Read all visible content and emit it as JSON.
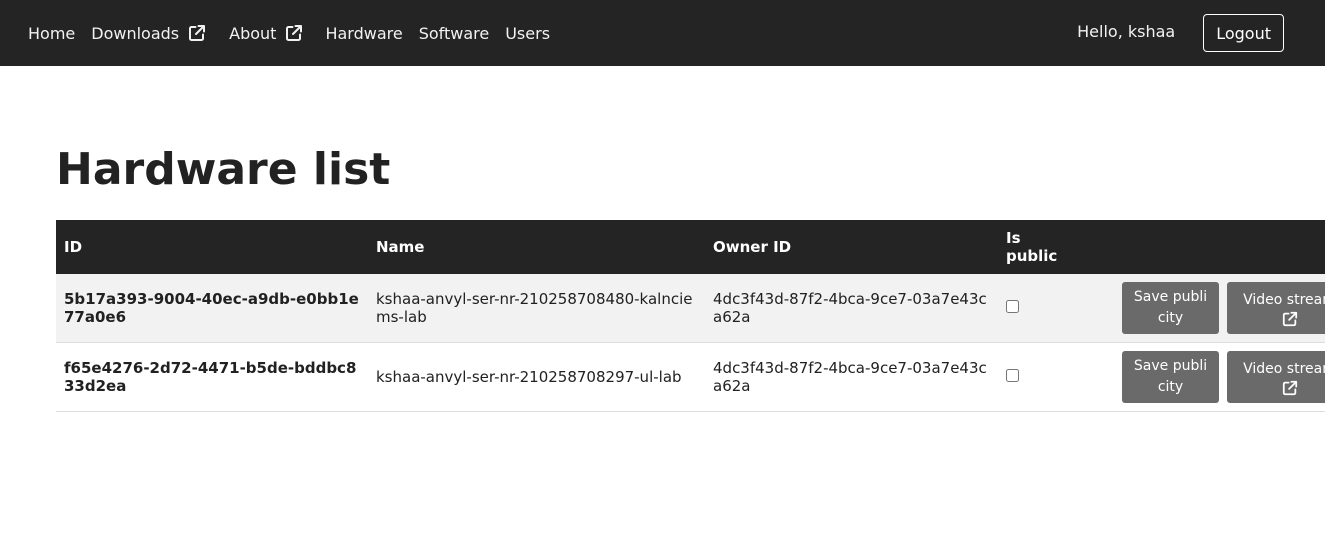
{
  "nav": {
    "links": [
      {
        "label": "Home"
      },
      {
        "label": "Downloads",
        "icon": "external-link-icon"
      },
      {
        "label": "About",
        "icon": "external-link-icon"
      },
      {
        "label": "Hardware"
      },
      {
        "label": "Software"
      },
      {
        "label": "Users"
      }
    ],
    "greeting": "Hello, kshaa",
    "logout_label": "Logout"
  },
  "page": {
    "title": "Hardware list"
  },
  "table": {
    "columns": [
      "ID",
      "Name",
      "Owner ID",
      "Is public",
      ""
    ],
    "rows": [
      {
        "id": "5b17a393-9004-40ec-a9db-e0bb1e77a0e6",
        "name": "kshaa-anvyl-ser-nr-210258708480-kalnciems-lab",
        "owner_id": "4dc3f43d-87f2-4bca-9ce7-03a7e43ca62a",
        "is_public": false,
        "save_label": "Save publicity",
        "video_label": "Video stream"
      },
      {
        "id": "f65e4276-2d72-4471-b5de-bddbc833d2ea",
        "name": "kshaa-anvyl-ser-nr-210258708297-ul-lab",
        "owner_id": "4dc3f43d-87f2-4bca-9ce7-03a7e43ca62a",
        "is_public": false,
        "save_label": "Save publicity",
        "video_label": "Video stream"
      }
    ]
  },
  "colors": {
    "navbar_bg": "#242424",
    "header_bg": "#242424",
    "button_bg": "#6a6a6a",
    "stripe_bg": "#f2f2f2"
  }
}
